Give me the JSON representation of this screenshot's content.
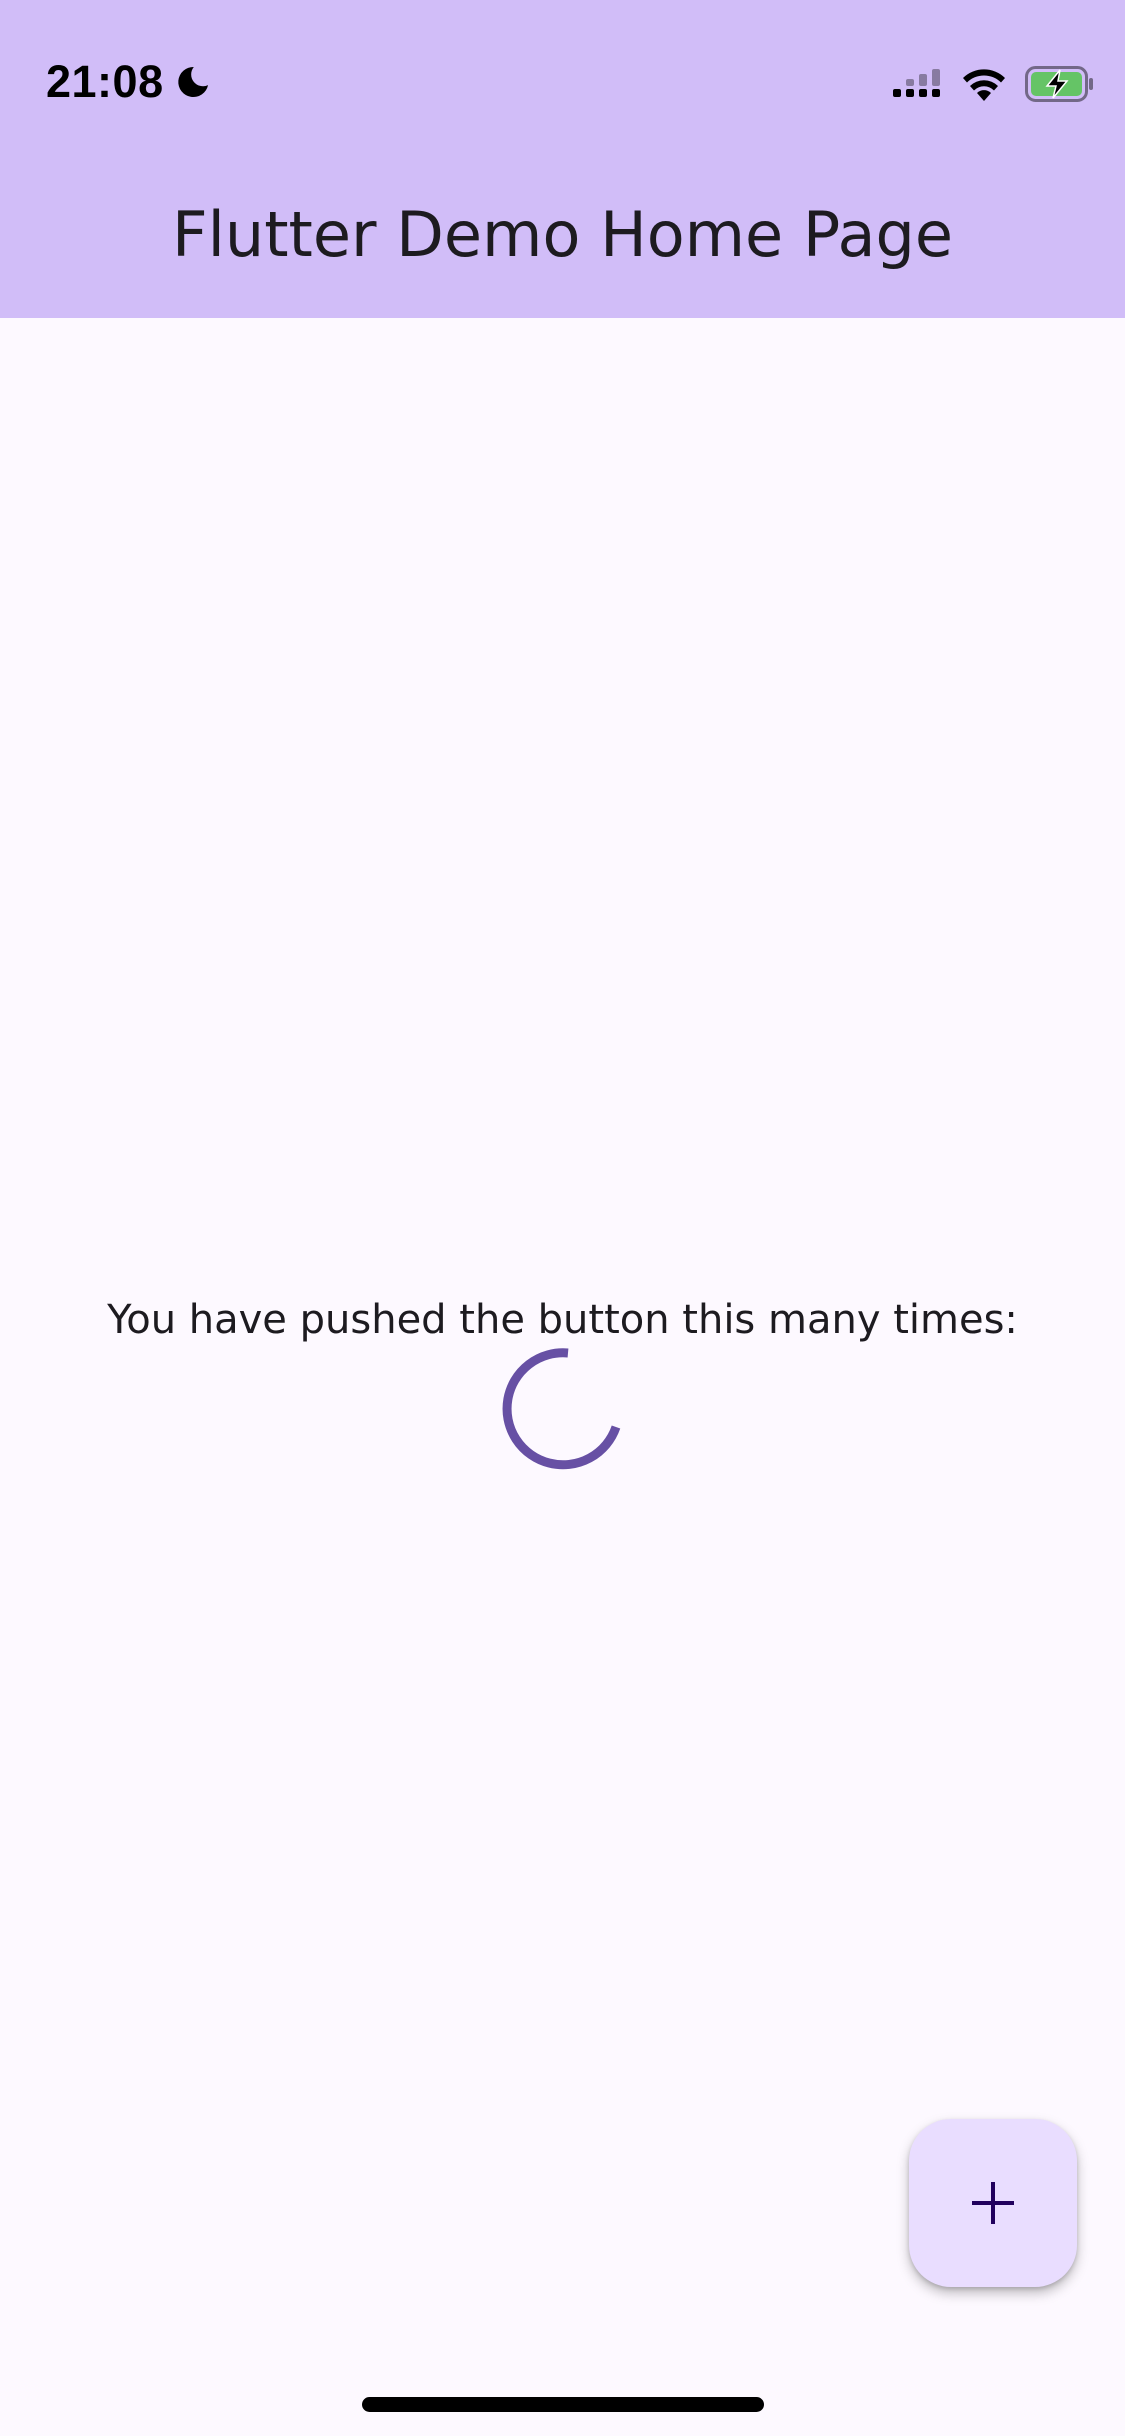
{
  "status_bar": {
    "time": "21:08",
    "icons": [
      "moon-icon",
      "cellular-signal-icon",
      "wifi-icon",
      "battery-charging-icon"
    ]
  },
  "app_bar": {
    "title": "Flutter Demo Home Page",
    "background_color": "#d1bdf8"
  },
  "main": {
    "counter_label": "You have pushed the button this many times:",
    "loading_indicator": "circular-progress-icon",
    "accent_color": "#6750a4"
  },
  "fab": {
    "icon": "plus-icon",
    "background_color": "#e9ddff"
  }
}
